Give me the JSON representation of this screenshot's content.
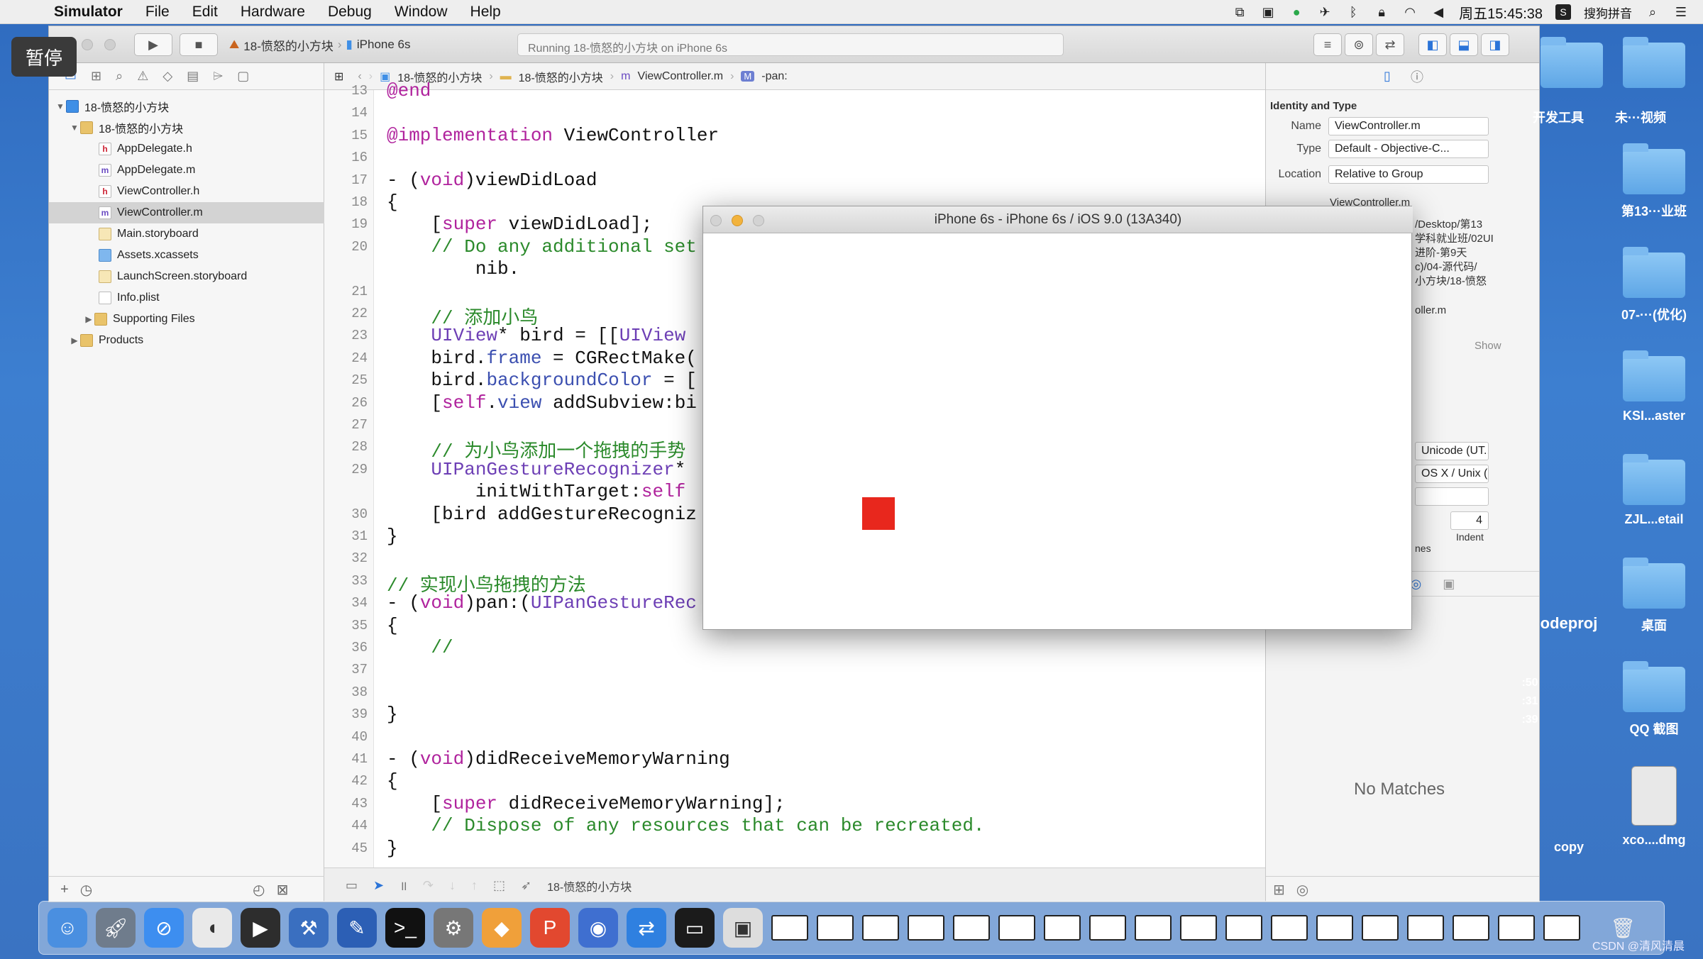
{
  "menubar": {
    "app": "Simulator",
    "items": [
      "File",
      "Edit",
      "Hardware",
      "Debug",
      "Window",
      "Help"
    ],
    "clock": "周五15:45:38",
    "input_method": "搜狗拼音"
  },
  "pause_label": "暂停",
  "toolbar": {
    "scheme_project": "18-愤怒的小方块",
    "scheme_device": "iPhone 6s",
    "activity": "Running 18-愤怒的小方块 on iPhone 6s"
  },
  "navigator": {
    "items": [
      {
        "label": "18-愤怒的小方块",
        "kind": "proj"
      },
      {
        "label": "18-愤怒的小方块",
        "kind": "folder"
      },
      {
        "label": "AppDelegate.h",
        "kind": "h"
      },
      {
        "label": "AppDelegate.m",
        "kind": "m"
      },
      {
        "label": "ViewController.h",
        "kind": "h"
      },
      {
        "label": "ViewController.m",
        "kind": "m"
      },
      {
        "label": "Main.storyboard",
        "kind": "sb"
      },
      {
        "label": "Assets.xcassets",
        "kind": "xa"
      },
      {
        "label": "LaunchScreen.storyboard",
        "kind": "sb"
      },
      {
        "label": "Info.plist",
        "kind": "pl"
      },
      {
        "label": "Supporting Files",
        "kind": "folder"
      },
      {
        "label": "Products",
        "kind": "folder"
      }
    ]
  },
  "jumpbar": {
    "crumb1": "18-愤怒的小方块",
    "crumb2": "18-愤怒的小方块",
    "crumb3": "ViewController.m",
    "crumb4": "-pan:"
  },
  "editor": {
    "line_numbers": [
      "13",
      "14",
      "15",
      "16",
      "17",
      "18",
      "19",
      "20",
      "",
      "21",
      "22",
      "23",
      "24",
      "25",
      "26",
      "27",
      "28",
      "29",
      "",
      "30",
      "31",
      "32",
      "33",
      "34",
      "35",
      "36",
      "37",
      "38",
      "39",
      "40",
      "41",
      "42",
      "43",
      "44",
      "45"
    ],
    "lines": [
      "@end",
      "",
      "@implementation ViewController",
      "",
      "- (void)viewDidLoad",
      "{",
      "    [super viewDidLoad];",
      "    // Do any additional set",
      "        nib.",
      "",
      "    // 添加小鸟",
      "    UIView* bird = [[UIView ",
      "    bird.frame = CGRectMake(",
      "    bird.backgroundColor = [",
      "    [self.view addSubview:bi",
      "",
      "    // 为小鸟添加一个拖拽的手势",
      "    UIPanGestureRecognizer*",
      "        initWithTarget:self",
      "    [bird addGestureRecogniz",
      "}",
      "",
      "// 实现小鸟拖拽的方法",
      "- (void)pan:(UIPanGestureRec",
      "{",
      "    //",
      "",
      "",
      "}",
      "",
      "- (void)didReceiveMemoryWarning",
      "{",
      "    [super didReceiveMemoryWarning];",
      "    // Dispose of any resources that can be recreated.",
      "}"
    ]
  },
  "debugbar": {
    "target": "18-愤怒的小方块"
  },
  "inspector": {
    "section": "Identity and Type",
    "name_label": "Name",
    "name_value": "ViewController.m",
    "type_label": "Type",
    "type_value": "Default - Objective-C...",
    "location_label": "Location",
    "location_value": "Relative to Group",
    "path_file": "ViewController.m",
    "path_lines": [
      "/Desktop/第13",
      "学科就业班/02UI",
      "进阶-第9天",
      "c)/04-源代码/",
      "小方块/18-愤怒"
    ],
    "full_path_tail": "oller.m",
    "show": "Show",
    "encoding": "Unicode (UT...",
    "line_endings": "OS X / Unix (LF)",
    "indent_value": "4",
    "indent_label": "Indent",
    "partial_label": "nes",
    "no_matches": "No Matches"
  },
  "simulator": {
    "title": "iPhone 6s - iPhone 6s / iOS 9.0 (13A340)",
    "bird_color": "#e8271d"
  },
  "desktop": {
    "labels": [
      "开发工具",
      "未···视频",
      "第13···业班",
      "07-···(优化)",
      "KSI...aster",
      "ZJL...etail",
      "桌面",
      "QQ 截图",
      "copy",
      "xco....dmg",
      "odeproj"
    ],
    "times": [
      ":50",
      ":31",
      ":39"
    ]
  },
  "watermark": "CSDN @清风清晨"
}
